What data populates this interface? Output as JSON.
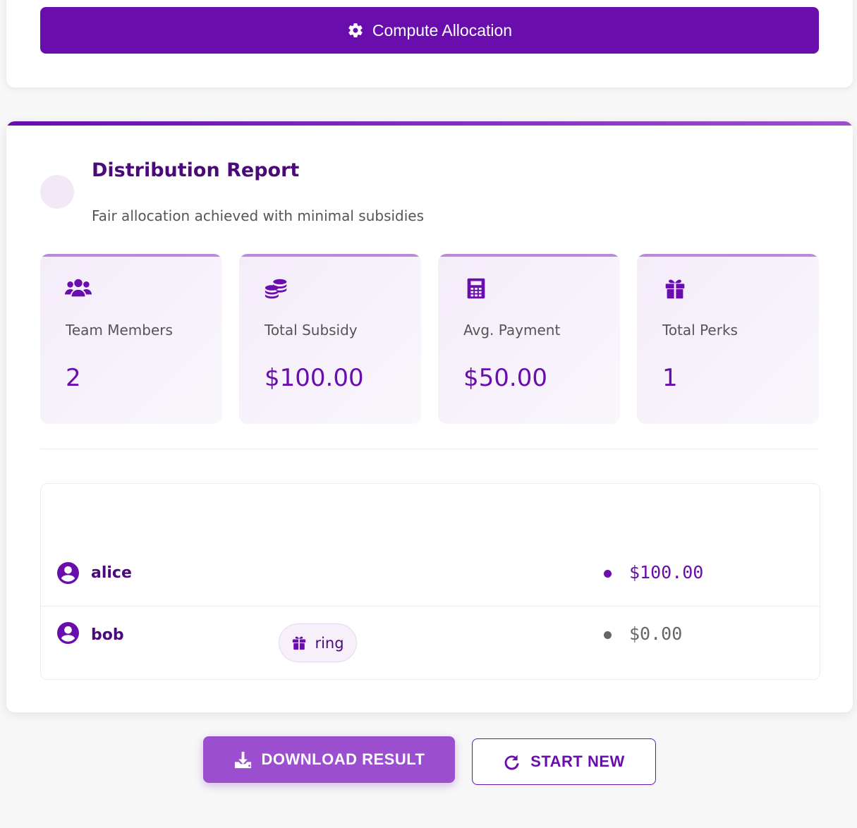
{
  "compute_button": {
    "label": "Compute Allocation",
    "icon": "gear-icon"
  },
  "report": {
    "title": "Distribution Report",
    "subtitle": "Fair allocation achieved with minimal subsidies",
    "stats": [
      {
        "icon": "users-icon",
        "label": "Team Members",
        "value": "2"
      },
      {
        "icon": "coins-icon",
        "label": "Total Subsidy",
        "value": "$100.00"
      },
      {
        "icon": "calculator-icon",
        "label": "Avg. Payment",
        "value": "$50.00"
      },
      {
        "icon": "gift-icon",
        "label": "Total Perks",
        "value": "1"
      }
    ],
    "rows": [
      {
        "name": "alice",
        "perks": [],
        "amount": "$100.00",
        "status_color": "#6a0dad"
      },
      {
        "name": "bob",
        "perks": [
          "ring"
        ],
        "amount": "$0.00",
        "status_color": "#666666"
      }
    ]
  },
  "actions": {
    "download_label": "DOWNLOAD RESULT",
    "start_new_label": "START NEW"
  },
  "colors": {
    "accent": "#6a0dad",
    "accent_light": "#9b4fcf",
    "title": "#4a0a7a"
  }
}
